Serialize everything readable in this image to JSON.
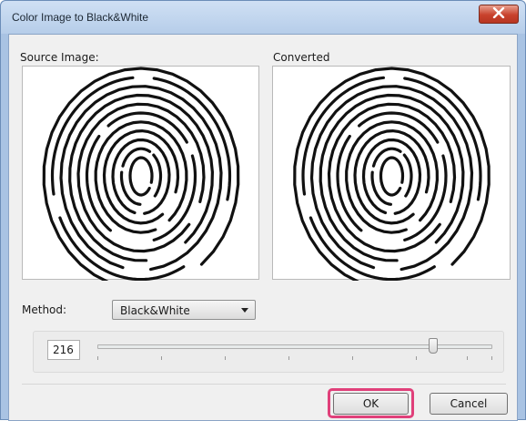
{
  "window": {
    "title": "Color Image to Black&White"
  },
  "panels": {
    "source_label": "Source Image:",
    "converted_label": "Converted"
  },
  "method": {
    "label": "Method:",
    "selected": "Black&White"
  },
  "threshold": {
    "value": "216",
    "level_fraction": 0.85
  },
  "buttons": {
    "ok": "OK",
    "cancel": "Cancel"
  },
  "colors": {
    "highlight": "#e0407a",
    "close_button": "#c8412c",
    "titlebar": "#b6cde9"
  },
  "icons": {
    "close": "close-icon",
    "dropdown": "chevron-down-icon"
  }
}
